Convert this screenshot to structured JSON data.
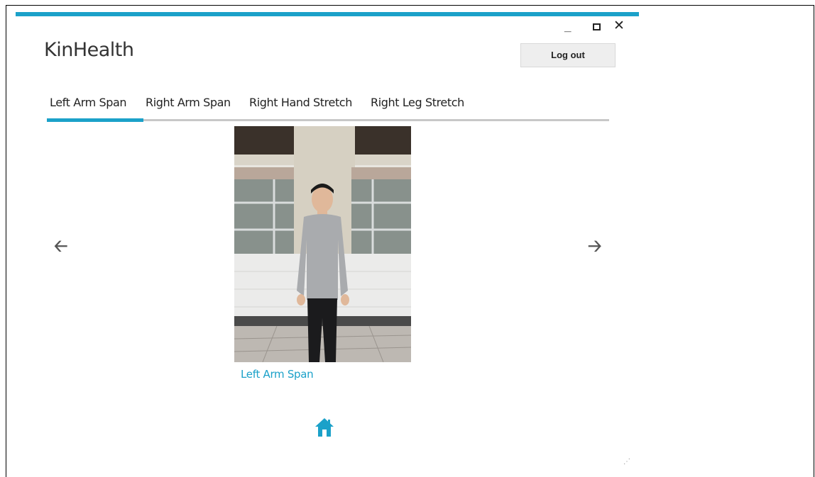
{
  "app": {
    "title": "KinHealth"
  },
  "window_controls": {
    "minimize": "_",
    "close": "✕"
  },
  "header": {
    "logout_label": "Log out"
  },
  "tabs": [
    {
      "label": "Left Arm Span",
      "active": true
    },
    {
      "label": "Right Arm Span",
      "active": false
    },
    {
      "label": "Right Hand Stretch",
      "active": false
    },
    {
      "label": "Right Leg Stretch",
      "active": false
    }
  ],
  "carousel": {
    "prev_icon": "arrow-left-icon",
    "next_icon": "arrow-right-icon",
    "caption": "Left Arm Span"
  },
  "footer": {
    "home_icon": "home-icon",
    "resize_icon": "resize-grip-icon"
  },
  "colors": {
    "accent": "#1ba1c9",
    "tab_divider": "#c8c8c8",
    "button_bg": "#eeeeee"
  }
}
